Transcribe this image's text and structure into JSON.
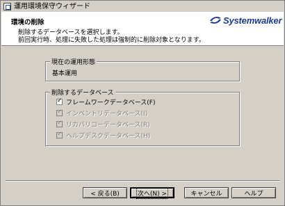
{
  "window": {
    "title": "運用環境保守ウィザード"
  },
  "header": {
    "title": "環境の削除",
    "description_line1": "削除するデータベースを選択します。",
    "description_line2": "前回実行時、処理に失敗した処理は強制的に削除対象となります。",
    "logo_text": "Systemwalker"
  },
  "current_mode": {
    "label": "現在の運用形態",
    "value": "基本運用"
  },
  "delete_db": {
    "label": "削除するデータベース",
    "options": [
      {
        "label": "フレームワークデータベース(F)",
        "checked": true,
        "enabled": true
      },
      {
        "label": "インベントリデータベース(I)",
        "checked": true,
        "enabled": false
      },
      {
        "label": "リカバリコーデータベース(R)",
        "checked": true,
        "enabled": false
      },
      {
        "label": "ヘルプデスクデータベース(H)",
        "checked": true,
        "enabled": false
      }
    ]
  },
  "buttons": {
    "back": "< 戻る(B)",
    "next": "次へ(N) >",
    "cancel": "キャンセル",
    "help": "ヘルプ"
  },
  "colors": {
    "dialog_bg": "#d4d0c8",
    "logo_blue": "#1c3a8c"
  }
}
